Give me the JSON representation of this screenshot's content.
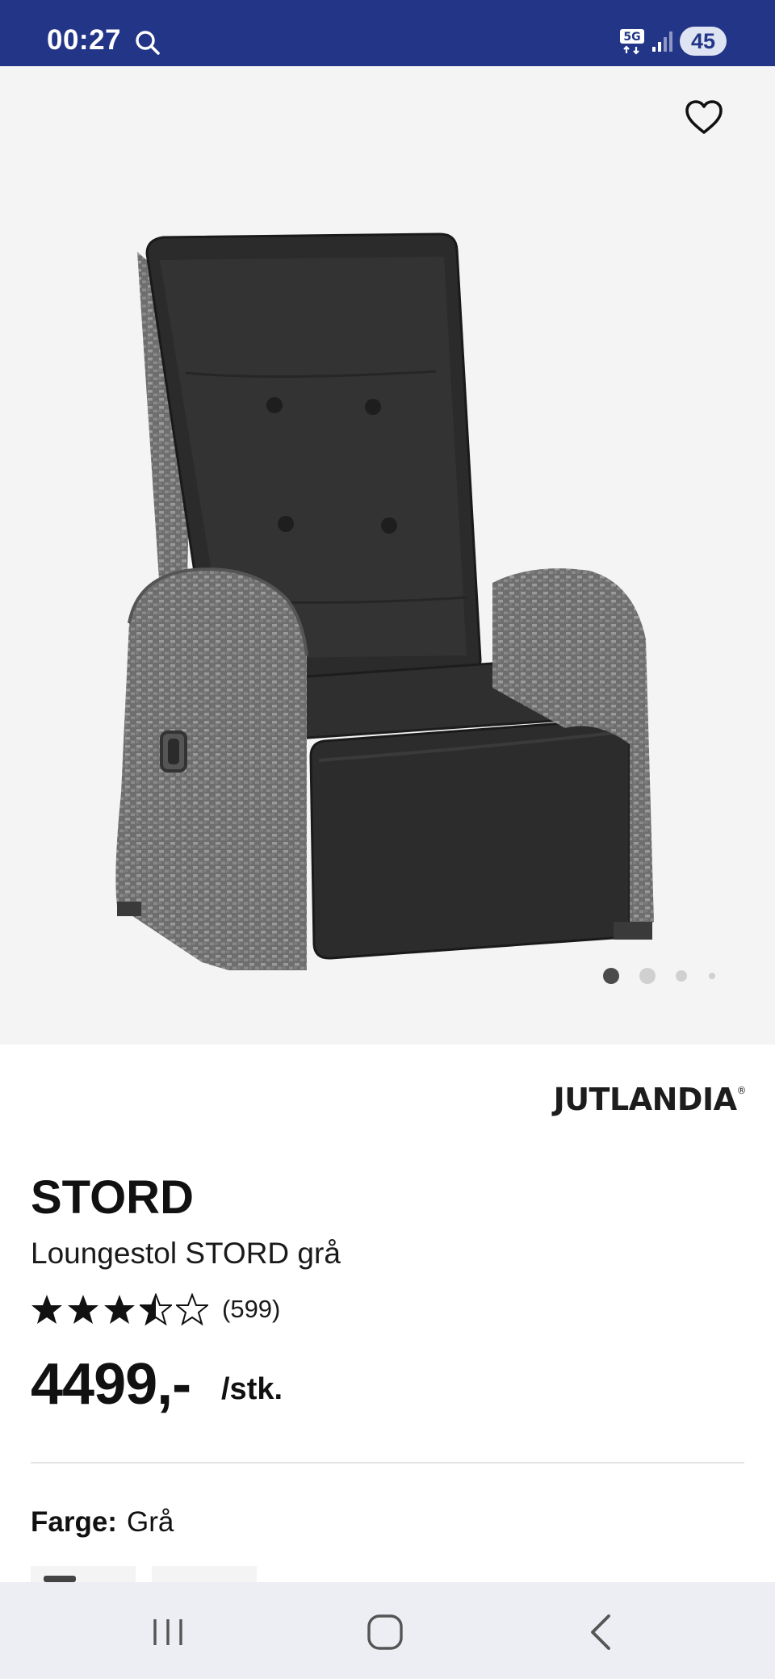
{
  "status_bar": {
    "time": "00:27",
    "network": "5G",
    "battery": "45",
    "icons": [
      "search-icon",
      "network-5g-icon",
      "signal-icon",
      "battery-icon"
    ]
  },
  "gallery": {
    "image": "Loungestol STORD grå",
    "page_indicator": {
      "current": 1,
      "total": 4
    },
    "favorite_icon": "heart-outline-icon"
  },
  "product": {
    "brand": "JUTLANDIA",
    "brand_mark": "®",
    "name": "STORD",
    "description": "Loungestol STORD grå",
    "rating": 3.5,
    "rating_max": 5,
    "review_count": "(599)",
    "price": "4499,-",
    "unit": "/stk."
  },
  "options": {
    "color_label": "Farge:",
    "color_value": "Grå"
  },
  "nav": {
    "icons": [
      "recent-apps-icon",
      "home-icon",
      "back-icon"
    ]
  },
  "colors": {
    "status_bar": "#223587",
    "gallery_bg": "#f4f4f4",
    "nav_bg": "#eceef3"
  }
}
